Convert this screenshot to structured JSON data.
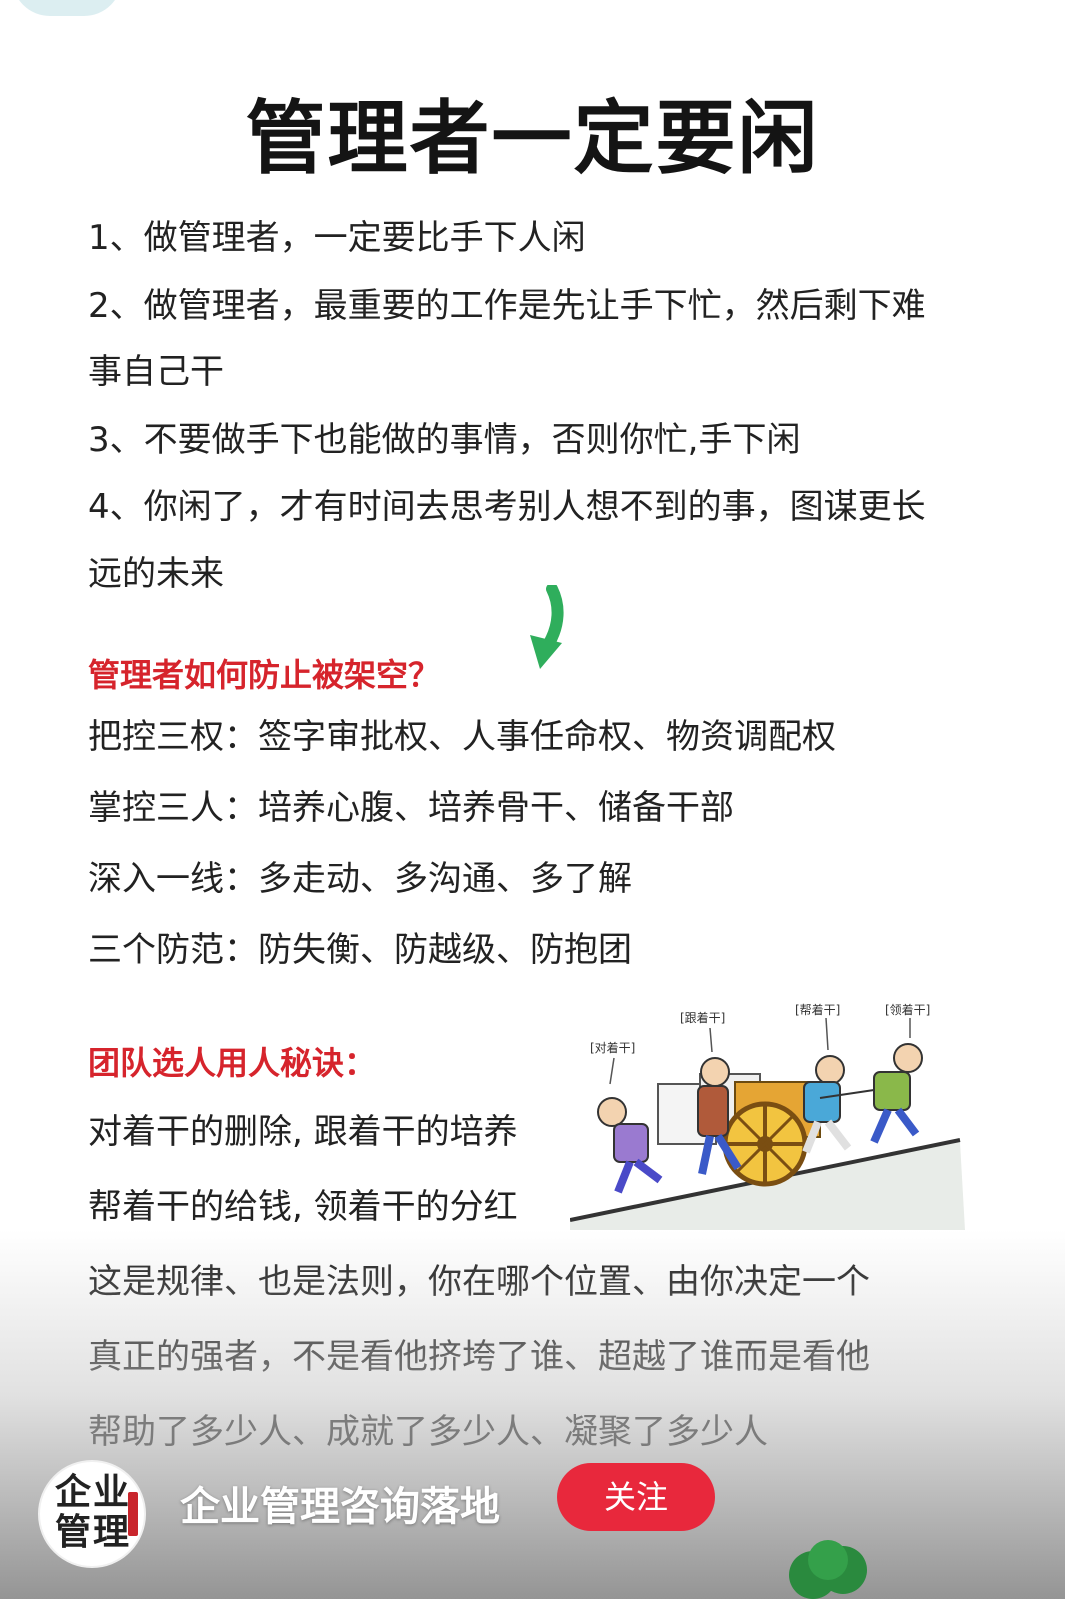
{
  "article": {
    "title": "管理者一定要闲",
    "points": [
      "1、做管理者，一定要比手下人闲",
      "2、做管理者，最重要的工作是先让手下忙，然后剩下难",
      "事自己干",
      "3、不要做手下也能做的事情，否则你忙,手下闲",
      "4、你闲了，才有时间去思考别人想不到的事，图谋更长",
      "远的未来"
    ],
    "section1": {
      "heading": "管理者如何防止被架空？",
      "items": [
        "把控三权：签字审批权、人事任命权、物资调配权",
        "掌控三人：培养心腹、培养骨干、储备干部",
        "深入一线：多走动、多沟通、多了解",
        "三个防范：防失衡、防越级、防抱团"
      ]
    },
    "section2": {
      "heading": "团队选人用人秘诀：",
      "items": [
        "对着干的删除, 跟着干的培养",
        "帮着干的给钱, 领着干的分红",
        "这是规律、也是法则，你在哪个位置、由你决定一个",
        "真正的强者，不是看他挤垮了谁、超越了谁而是看他",
        "帮助了多少人、成就了多少人、凝聚了多少人"
      ]
    },
    "illustration_labels": [
      "[对着干]",
      "[跟着干]",
      "[帮着干]",
      "[领着干]"
    ]
  },
  "overlay": {
    "avatar_text": "企业管理",
    "channel_name": "企业管理咨询落地",
    "follow_label": "关注"
  },
  "colors": {
    "heading_red": "#d6242c",
    "follow_red": "#e8283c",
    "arrow_green": "#2fae5c"
  }
}
